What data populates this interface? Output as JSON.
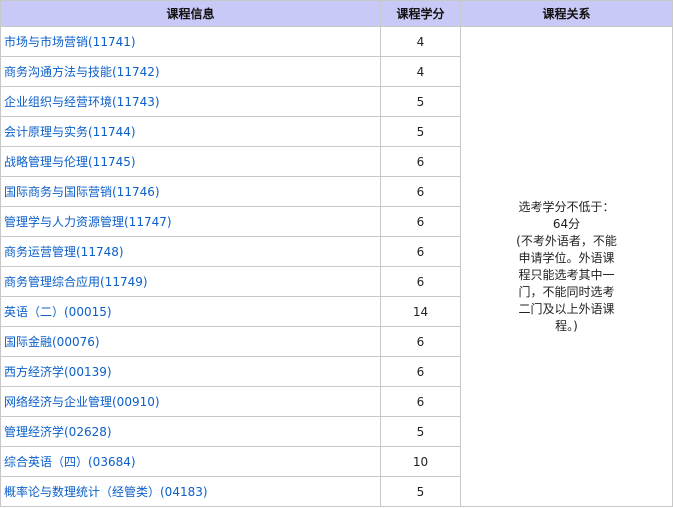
{
  "headers": {
    "course_info": "课程信息",
    "credits": "课程学分",
    "relation": "课程关系"
  },
  "courses": [
    {
      "name": "市场与市场营销(11741)",
      "credit": "4"
    },
    {
      "name": "商务沟通方法与技能(11742)",
      "credit": "4"
    },
    {
      "name": "企业组织与经营环境(11743)",
      "credit": "5"
    },
    {
      "name": "会计原理与实务(11744)",
      "credit": "5"
    },
    {
      "name": "战略管理与伦理(11745)",
      "credit": "6"
    },
    {
      "name": "国际商务与国际营销(11746)",
      "credit": "6"
    },
    {
      "name": "管理学与人力资源管理(11747)",
      "credit": "6"
    },
    {
      "name": "商务运营管理(11748)",
      "credit": "6"
    },
    {
      "name": "商务管理综合应用(11749)",
      "credit": "6"
    },
    {
      "name": "英语（二）(00015)",
      "credit": "14"
    },
    {
      "name": "国际金融(00076)",
      "credit": "6"
    },
    {
      "name": "西方经济学(00139)",
      "credit": "6"
    },
    {
      "name": "网络经济与企业管理(00910)",
      "credit": "6"
    },
    {
      "name": "管理经济学(02628)",
      "credit": "5"
    },
    {
      "name": "综合英语（四）(03684)",
      "credit": "10"
    },
    {
      "name": "概率论与数理统计（经管类）(04183)",
      "credit": "5"
    }
  ],
  "relation_lines": [
    "选考学分不低于：",
    "64分",
    "(不考外语者，不能",
    "申请学位。外语课",
    "程只能选考其中一",
    "门，不能同时选考",
    "二门及以上外语课",
    "程。)"
  ],
  "colors": {
    "header_bg": "#c9c9f7",
    "link": "#0b5fc9",
    "border": "#c8c8c8"
  }
}
